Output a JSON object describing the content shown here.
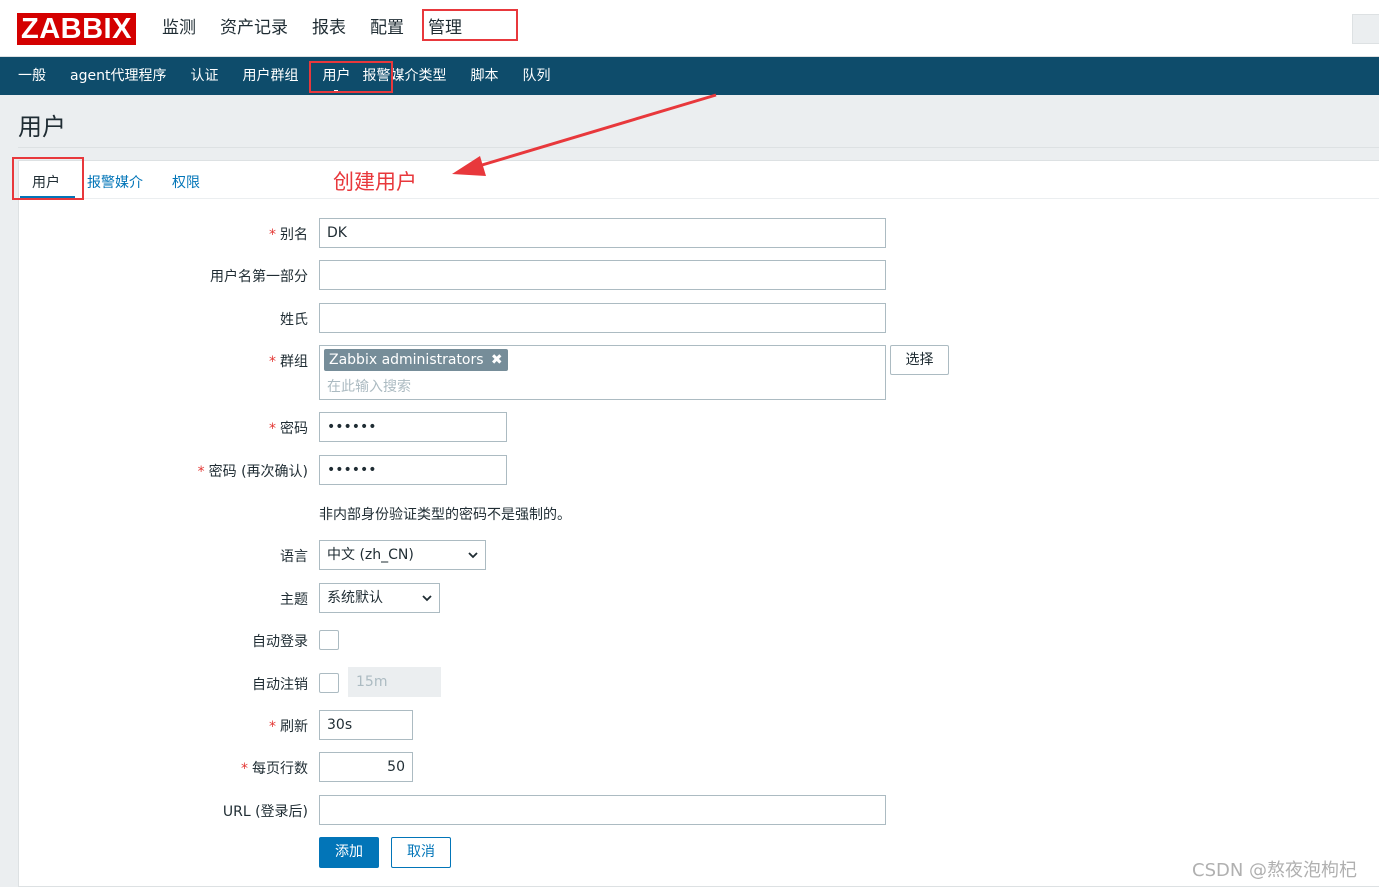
{
  "topbar": {
    "logo": "ZABBIX",
    "nav": [
      "监测",
      "资产记录",
      "报表",
      "配置",
      "管理"
    ]
  },
  "subnav": [
    "一般",
    "agent代理程序",
    "认证",
    "用户群组",
    "用户",
    "报警媒介类型",
    "脚本",
    "队列"
  ],
  "page": {
    "title": "用户"
  },
  "tabs": [
    "用户",
    "报警媒介",
    "权限"
  ],
  "form": {
    "alias": {
      "label": "别名",
      "value": "DK"
    },
    "name": {
      "label": "用户名第一部分",
      "value": ""
    },
    "surname": {
      "label": "姓氏",
      "value": ""
    },
    "groups": {
      "label": "群组",
      "chip": "Zabbix administrators",
      "placeholder": "在此输入搜索",
      "select_button": "选择"
    },
    "password": {
      "label": "密码",
      "value": "••••••"
    },
    "password_confirm": {
      "label": "密码 (再次确认)",
      "value": "••••••"
    },
    "password_hint": "非内部身份验证类型的密码不是强制的。",
    "language": {
      "label": "语言",
      "value": "中文 (zh_CN)"
    },
    "theme": {
      "label": "主题",
      "value": "系统默认"
    },
    "autologin": {
      "label": "自动登录",
      "checked": false
    },
    "autologout": {
      "label": "自动注销",
      "checked": false,
      "value": "15m"
    },
    "refresh": {
      "label": "刷新",
      "value": "30s"
    },
    "rows_per_page": {
      "label": "每页行数",
      "value": "50"
    },
    "url": {
      "label": "URL (登录后)",
      "value": ""
    },
    "add_button": "添加",
    "cancel_button": "取消",
    "required_mark": "*"
  },
  "annotation": {
    "text": "创建用户",
    "color": "#e8383c"
  },
  "watermark": "CSDN @熬夜泡枸杞",
  "colors": {
    "brand_red": "#d40000",
    "subnav_bg": "#0e4c6b",
    "accent": "#0275b8"
  }
}
